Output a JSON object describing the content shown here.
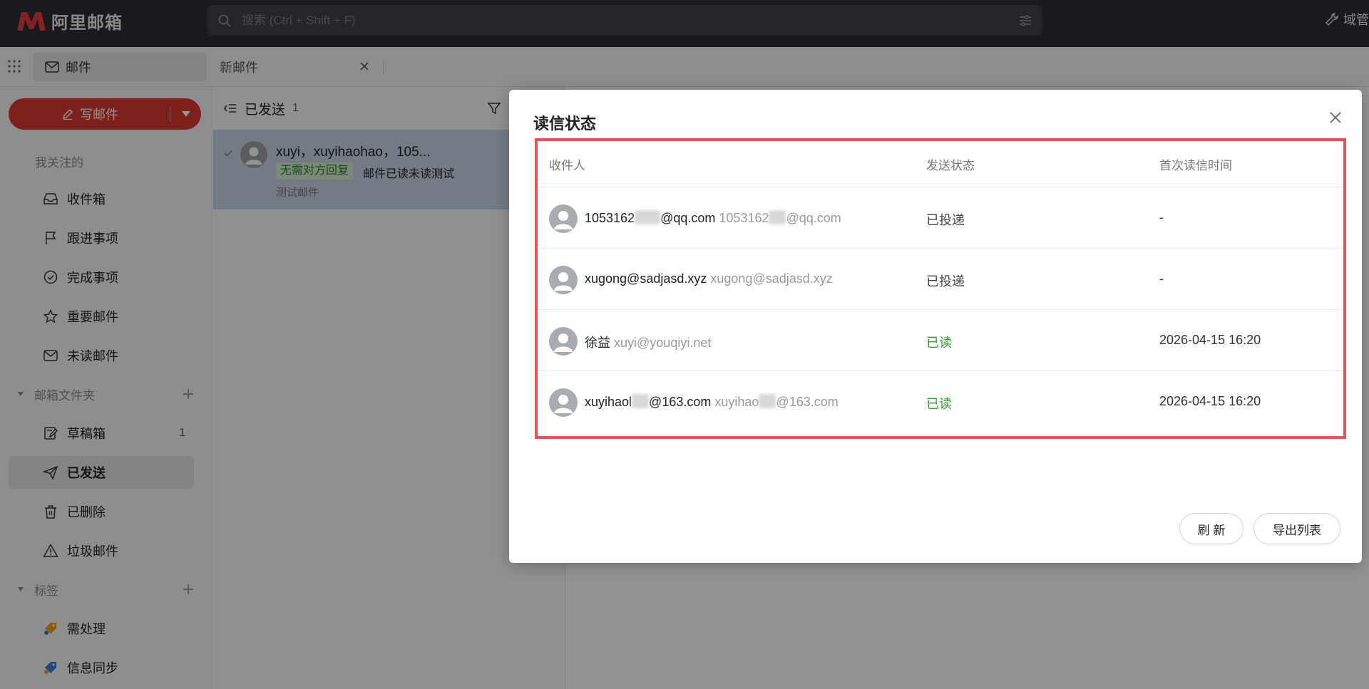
{
  "app": {
    "logo_text": "阿里邮箱",
    "admin_label": "域管"
  },
  "search": {
    "placeholder": "搜索 (Ctrl + Shift + F)"
  },
  "tabs": [
    {
      "label": "邮件",
      "icon": "mail-icon"
    },
    {
      "label": "新邮件",
      "icon": "close-icon"
    }
  ],
  "sidebar": {
    "compose_label": "写邮件",
    "followed_label": "我关注的",
    "items": [
      {
        "label": "收件箱",
        "icon": "inbox-icon"
      },
      {
        "label": "跟进事项",
        "icon": "flag-icon"
      },
      {
        "label": "完成事项",
        "icon": "check-circle-icon"
      },
      {
        "label": "重要邮件",
        "icon": "star-icon"
      },
      {
        "label": "未读邮件",
        "icon": "unread-mail-icon"
      }
    ],
    "folders_label": "邮箱文件夹",
    "folders": [
      {
        "label": "草稿箱",
        "icon": "draft-icon",
        "count": "1"
      },
      {
        "label": "已发送",
        "icon": "send-icon",
        "count": ""
      },
      {
        "label": "已删除",
        "icon": "trash-icon",
        "count": ""
      },
      {
        "label": "垃圾邮件",
        "icon": "warning-icon",
        "count": ""
      }
    ],
    "tags_label": "标签",
    "tags": [
      {
        "label": "需处理",
        "icon": "tag-orange-icon",
        "color": "#f0a020"
      },
      {
        "label": "信息同步",
        "icon": "tag-blue-icon",
        "color": "#3a7bd5"
      }
    ]
  },
  "list": {
    "title": "已发送",
    "count": "1",
    "message": {
      "from": "xuyi，xuyihaohao，105...",
      "tag": "无需对方回复",
      "subject": "邮件已读未读测试",
      "preview": "测试邮件"
    }
  },
  "modal": {
    "title": "读信状态",
    "columns": [
      "收件人",
      "发送状态",
      "首次读信时间"
    ],
    "rows": [
      {
        "name_a": "1053162",
        "name_b": "@qq.com",
        "addr_a": "1053162",
        "addr_b": "@qq.com",
        "status": "已投递",
        "read": false,
        "time": "-"
      },
      {
        "name_a": "xugong@sadjasd.xyz",
        "name_b": "",
        "addr_a": "xugong@sadjasd.xyz",
        "addr_b": "",
        "status": "已投递",
        "read": false,
        "time": "-"
      },
      {
        "name_a": "徐益",
        "name_b": "",
        "addr_a": "xuyi@youqiyi.net",
        "addr_b": "",
        "status": "已读",
        "read": true,
        "time": "2026-04-15 16:20"
      },
      {
        "name_a": "xuyihaol",
        "name_b": "@163.com",
        "addr_a": "xuyihao",
        "addr_b": "@163.com",
        "status": "已读",
        "read": true,
        "time": "2026-04-15 16:20"
      }
    ],
    "refresh_label": "刷 新",
    "export_label": "导出列表"
  },
  "colors": {
    "accent": "#d8362d",
    "read_status": "#2e9e2e",
    "highlight_border": "#e05555",
    "topbar": "#2b2e33"
  }
}
